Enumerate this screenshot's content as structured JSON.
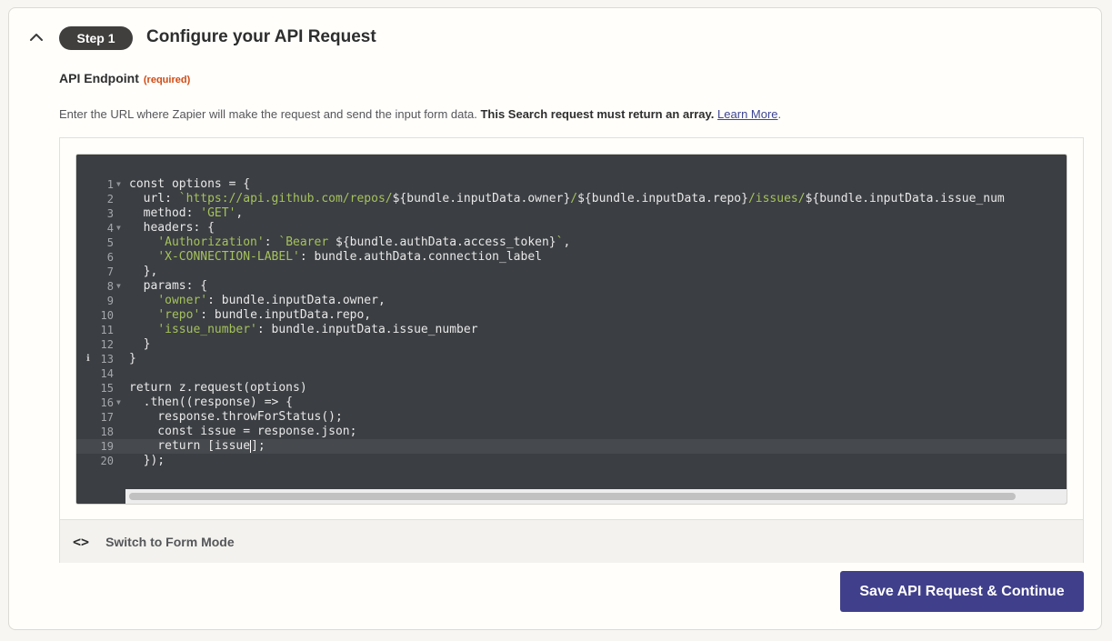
{
  "step": {
    "badge": "Step 1",
    "title": "Configure your API Request",
    "collapse_icon": "chevron-up-icon"
  },
  "field": {
    "label": "API Endpoint",
    "required": "(required)",
    "help_prefix": "Enter the URL where Zapier will make the request and send the input form data.",
    "help_bold": "This Search request must return an array.",
    "help_link": "Learn More",
    "help_suffix": "."
  },
  "editor": {
    "lines": [
      {
        "n": "1",
        "fold": true,
        "html": "const options = {"
      },
      {
        "n": "2",
        "html": "  url: <span class=\"str\">`https://api.github.com/repos/</span>${bundle.inputData.owner}<span class=\"str\">/</span>${bundle.inputData.repo}<span class=\"str\">/issues/</span>${bundle.inputData.issue_num"
      },
      {
        "n": "3",
        "html": "  method: <span class=\"str\">'GET'</span>,"
      },
      {
        "n": "4",
        "fold": true,
        "html": "  headers: {"
      },
      {
        "n": "5",
        "html": "    <span class=\"str\">'Authorization'</span>: <span class=\"str\">`Bearer </span>${bundle.authData.access_token}<span class=\"str\">`</span>,"
      },
      {
        "n": "6",
        "html": "    <span class=\"str\">'X-CONNECTION-LABEL'</span>: bundle.authData.connection_label"
      },
      {
        "n": "7",
        "html": "  },"
      },
      {
        "n": "8",
        "fold": true,
        "html": "  params: {"
      },
      {
        "n": "9",
        "html": "    <span class=\"str\">'owner'</span>: bundle.inputData.owner,"
      },
      {
        "n": "10",
        "html": "    <span class=\"str\">'repo'</span>: bundle.inputData.repo,"
      },
      {
        "n": "11",
        "html": "    <span class=\"str\">'issue_number'</span>: bundle.inputData.issue_number"
      },
      {
        "n": "12",
        "html": "  }"
      },
      {
        "n": "13",
        "marker": true,
        "html": "}"
      },
      {
        "n": "14",
        "html": ""
      },
      {
        "n": "15",
        "html": "return z.request(options)"
      },
      {
        "n": "16",
        "fold": true,
        "html": "  .then((response) =&gt; {"
      },
      {
        "n": "17",
        "html": "    response.throwForStatus();"
      },
      {
        "n": "18",
        "html": "    const issue = response.json;"
      },
      {
        "n": "19",
        "active": true,
        "html": "    return [issue<span class=\"cursor\"></span>];"
      },
      {
        "n": "20",
        "html": "  });"
      }
    ]
  },
  "mode": {
    "icon": "<>",
    "icon_name": "code-brackets-icon",
    "label": "Switch to Form Mode"
  },
  "actions": {
    "save_label": "Save API Request & Continue"
  },
  "colors": {
    "primary": "#403f8b",
    "required": "#d14a12",
    "editor_bg": "#3b3e42",
    "string": "#a5c25c"
  }
}
